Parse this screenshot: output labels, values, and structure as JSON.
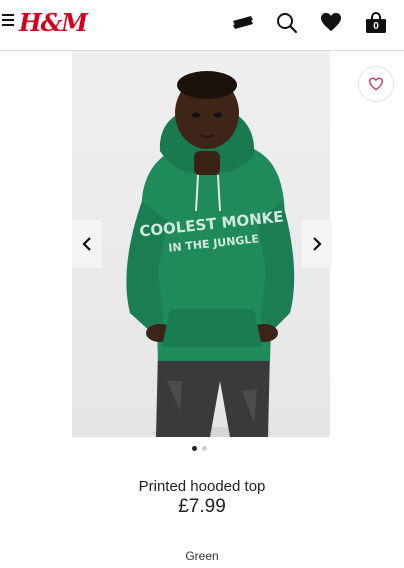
{
  "header": {
    "logo": "H&M",
    "bag_count": "0",
    "icons": [
      "menu-icon",
      "card-icon",
      "search-icon",
      "heart-icon",
      "bag-icon"
    ]
  },
  "gallery": {
    "hoodie_text_line1": "COOLEST MONKE",
    "hoodie_text_line2": "IN THE JUNGLE",
    "prev_icon": "chevron-left",
    "next_icon": "chevron-right",
    "slide_count": 2,
    "active_slide": 1
  },
  "product": {
    "title": "Printed hooded top",
    "price": "£7.99",
    "color": "Green"
  },
  "colors": {
    "brand_red": "#d3001c",
    "hoodie_green": "#1f8a5a",
    "favorite_heart": "#c8294a"
  }
}
